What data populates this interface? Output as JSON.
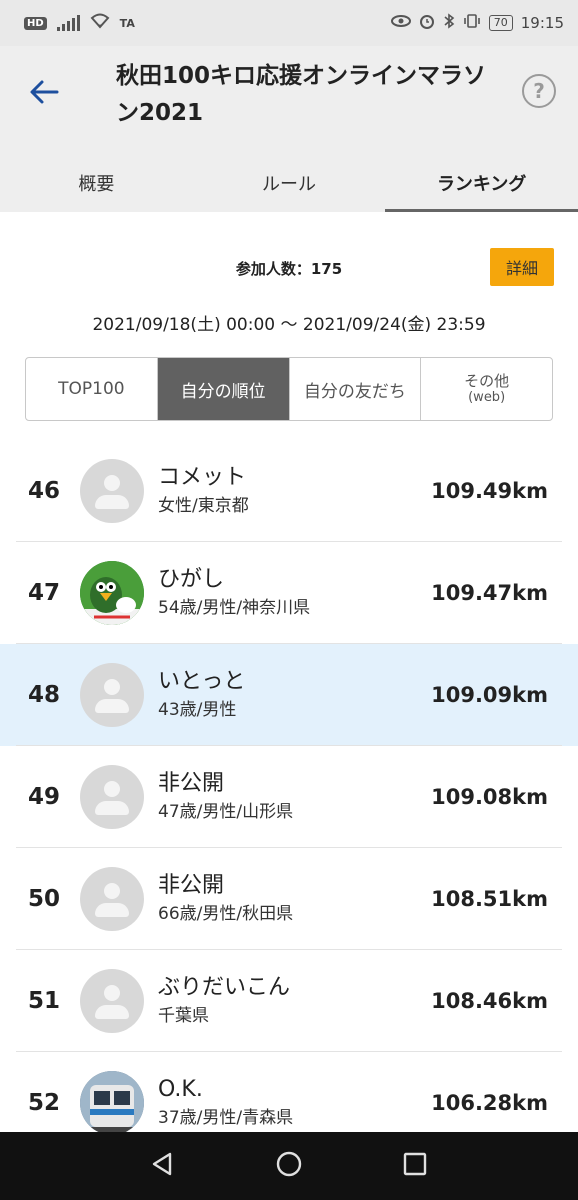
{
  "status_bar": {
    "hd": "HD",
    "ta": "TA",
    "battery": "70",
    "time": "19:15"
  },
  "header": {
    "title": "秋田100キロ応援オンラインマラソン2021",
    "help_symbol": "?"
  },
  "tabs": [
    {
      "label": "概要",
      "active": false
    },
    {
      "label": "ルール",
      "active": false
    },
    {
      "label": "ランキング",
      "active": true
    }
  ],
  "info": {
    "participants": "参加人数：175",
    "detail_button": "詳細",
    "period": "2021/09/18(土) 00:00 〜 2021/09/24(金) 23:59"
  },
  "segments": {
    "top100": "TOP100",
    "my_rank": "自分の順位",
    "my_friends": "自分の友だち",
    "other": "その他",
    "other_sub": "(web)"
  },
  "ranking": [
    {
      "rank": "46",
      "name": "コメット",
      "meta": "女性/東京都",
      "distance": "109.49km",
      "avatar": "default"
    },
    {
      "rank": "47",
      "name": "ひがし",
      "meta": "54歳/男性/神奈川県",
      "distance": "109.47km",
      "avatar": "bird-photo"
    },
    {
      "rank": "48",
      "name": "いとっと",
      "meta": "43歳/男性",
      "distance": "109.09km",
      "avatar": "default"
    },
    {
      "rank": "49",
      "name": "非公開",
      "meta": "47歳/男性/山形県",
      "distance": "109.08km",
      "avatar": "default"
    },
    {
      "rank": "50",
      "name": "非公開",
      "meta": "66歳/男性/秋田県",
      "distance": "108.51km",
      "avatar": "default"
    },
    {
      "rank": "51",
      "name": "ぶりだいこん",
      "meta": "千葉県",
      "distance": "108.46km",
      "avatar": "default"
    },
    {
      "rank": "52",
      "name": "O.K.",
      "meta": "37歳/男性/青森県",
      "distance": "106.28km",
      "avatar": "train-photo"
    }
  ],
  "colors": {
    "accent_orange": "#f5a60c",
    "highlight_row": "#e3f1fc",
    "back_arrow": "#1d4f9e"
  }
}
